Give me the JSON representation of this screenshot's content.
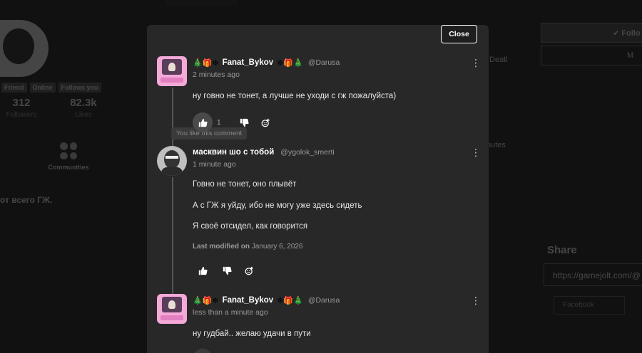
{
  "background": {
    "tags": [
      "Friend",
      "Online",
      "Follows you"
    ],
    "stats": [
      {
        "value": "312",
        "label": "Followers"
      },
      {
        "value": "82.3k",
        "label": "Likes"
      }
    ],
    "communities_label": "Communities",
    "side_text": "от всего ГЖ.",
    "follow_label": "✔ Follo",
    "m_label": "M",
    "death_label": "Deatl",
    "minutes_label": "nutes",
    "share_title": "Share",
    "share_url": "https://gamejolt.com/@",
    "facebook_label": "Facebook"
  },
  "modal": {
    "close_label": "Close",
    "tooltip": "You like this comment",
    "comments": [
      {
        "prefix_emoji": "🎄🎁❄",
        "username": "Fanat_Bykov",
        "suffix_emoji": "❄🎁🎄",
        "handle": "@Darusa",
        "time": "2 minutes ago",
        "lines": [
          "ну говно не тонет, а лучше не уходи с гж пожалуйста)"
        ],
        "like_count": "1"
      },
      {
        "username": "масквин шо с тобой",
        "handle": "@ygolok_smerti",
        "time": "1 minute ago",
        "lines": [
          "Говно не тонет, оно плывёт",
          "А с ГЖ я уйду, ибо не могу уже здесь сидеть",
          "Я своё отсидел, как говорится"
        ],
        "modified_prefix": "Last modified on",
        "modified_date": "January 6, 2026"
      },
      {
        "prefix_emoji": "🎄🎁❄",
        "username": "Fanat_Bykov",
        "suffix_emoji": "❄🎁🎄",
        "handle": "@Darusa",
        "time": "less than a minute ago",
        "lines": [
          "ну гудбай.. желаю удачи в пути"
        ]
      }
    ]
  },
  "colors": {
    "modal_bg": "#282828",
    "page_bg": "#111111",
    "avatar_pink": "#f4a9d8"
  }
}
